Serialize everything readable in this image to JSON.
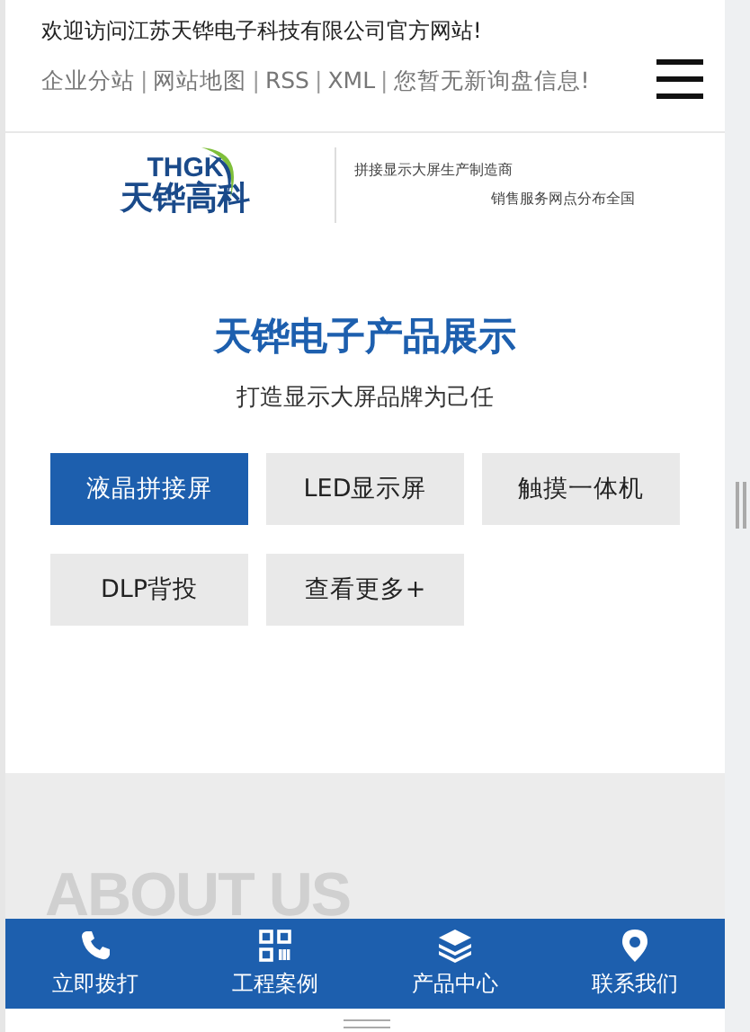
{
  "top_bar": {
    "welcome": "欢迎访问江苏天铧电子科技有限公司官方网站!",
    "separator": "|",
    "links": [
      "企业分站",
      "网站地图",
      "RSS",
      "XML",
      "您暂无新询盘信息!"
    ]
  },
  "logo": {
    "mark": "THGK",
    "name": "天铧高科",
    "tagline_1": "拼接显示大屏生产制造商",
    "tagline_2": "销售服务网点分布全国"
  },
  "products": {
    "title": "天铧电子产品展示",
    "subtitle": "打造显示大屏品牌为己任",
    "categories": [
      {
        "label": "液晶拼接屏",
        "selected": true
      },
      {
        "label": "LED显示屏",
        "selected": false
      },
      {
        "label": "触摸一体机",
        "selected": false
      },
      {
        "label": "DLP背投",
        "selected": false
      },
      {
        "label": "查看更多+",
        "selected": false
      }
    ]
  },
  "about": {
    "watermark": "ABOUT US"
  },
  "bottom_nav": [
    {
      "label": "立即拨打",
      "kind": "phone"
    },
    {
      "label": "工程案例",
      "kind": "grid"
    },
    {
      "label": "产品中心",
      "kind": "layers"
    },
    {
      "label": "联系我们",
      "kind": "pin"
    }
  ]
}
